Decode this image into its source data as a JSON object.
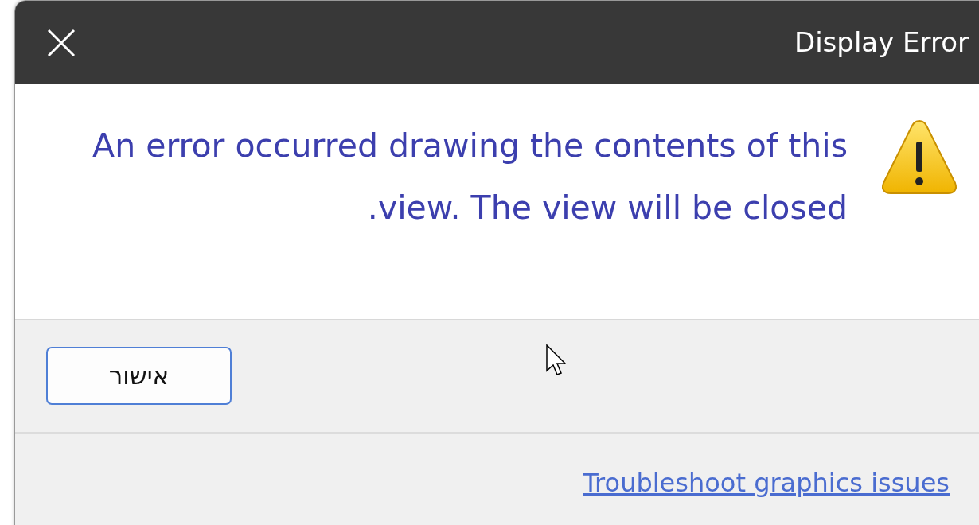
{
  "window": {
    "title": "Display Error"
  },
  "message": "An error occurred drawing the contents of this view. The view will be closed.",
  "buttons": [
    {
      "label": "אישור",
      "selected": true
    }
  ],
  "link": "Troubleshoot graphics issues"
}
